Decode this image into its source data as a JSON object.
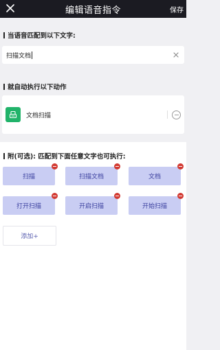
{
  "nav": {
    "title": "编辑语音指令",
    "save_label": "保存"
  },
  "section1": {
    "title": "当语音匹配到以下文字:"
  },
  "input": {
    "value": "扫描文档"
  },
  "section2": {
    "title": "就自动执行以下动作"
  },
  "action": {
    "label": "文档扫描"
  },
  "section3": {
    "title": "附(可选): 匹配到下面任意文字也可执行:"
  },
  "phrases": [
    "扫描",
    "扫描文档",
    "文档",
    "打开扫描",
    "开启扫描",
    "开始扫描"
  ],
  "add_label": "添加+",
  "colors": {
    "nav_bg": "#1b1b22",
    "chip_bg": "#c9cdf3",
    "badge": "#d23a32",
    "action_icon_bg": "#21b36a"
  }
}
